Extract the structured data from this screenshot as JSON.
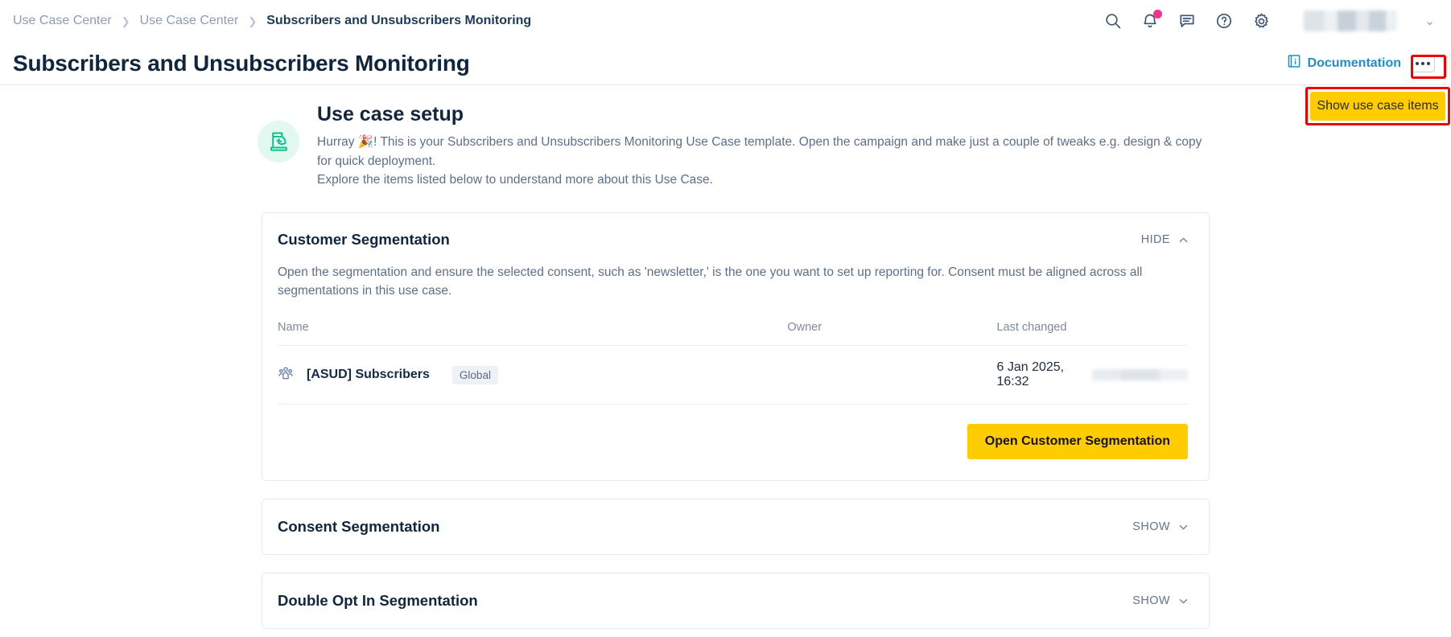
{
  "breadcrumb": [
    {
      "label": "Use Case Center",
      "current": false
    },
    {
      "label": "Use Case Center",
      "current": false
    },
    {
      "label": "Subscribers and Unsubscribers Monitoring",
      "current": true
    }
  ],
  "topbar": {
    "search_icon": "search-icon",
    "notifications_icon": "bell-icon",
    "messages_icon": "chat-icon",
    "help_icon": "help-circle-icon",
    "settings_icon": "gear-icon",
    "user_chevron": "⌄"
  },
  "header": {
    "title": "Subscribers and Unsubscribers Monitoring",
    "documentation_label": "Documentation",
    "documentation_icon": "book-info-icon",
    "more_menu_icon": "three-dots-icon",
    "show_items_button": "Show use case items"
  },
  "setup": {
    "icon": "ballot-box-icon",
    "title": "Use case setup",
    "paragraph1": "Hurray 🎉! This is your Subscribers and Unsubscribers Monitoring Use Case template. Open the campaign and make just a couple of tweaks e.g. design & copy for quick deployment.",
    "paragraph2": "Explore the items listed below to understand more about this Use Case."
  },
  "cards": [
    {
      "title": "Customer Segmentation",
      "toggle_label": "HIDE",
      "toggle_icon": "chevron-up-icon",
      "expanded": true,
      "description": "Open the segmentation and ensure the selected consent, such as 'newsletter,' is the one you want to set up reporting for. Consent must be aligned across all segmentations in this use case.",
      "table": {
        "columns": [
          "Name",
          "Owner",
          "Last changed"
        ],
        "rows": [
          {
            "icon": "people-group-icon",
            "name": "[ASUD] Subscribers",
            "badge": "Global",
            "owner": "",
            "last_changed": "6 Jan 2025, 16:32"
          }
        ]
      },
      "cta_label": "Open Customer Segmentation"
    },
    {
      "title": "Consent Segmentation",
      "toggle_label": "SHOW",
      "toggle_icon": "chevron-down-icon",
      "expanded": false
    },
    {
      "title": "Double Opt In Segmentation",
      "toggle_label": "SHOW",
      "toggle_icon": "chevron-down-icon",
      "expanded": false
    }
  ],
  "colors": {
    "accent_yellow": "#ffcc00",
    "link_blue": "#1d8ecf",
    "title_navy": "#10263e",
    "highlight_red": "#ef0000",
    "icon_green": "#00c389",
    "notification_pink": "#ff2d8a"
  }
}
